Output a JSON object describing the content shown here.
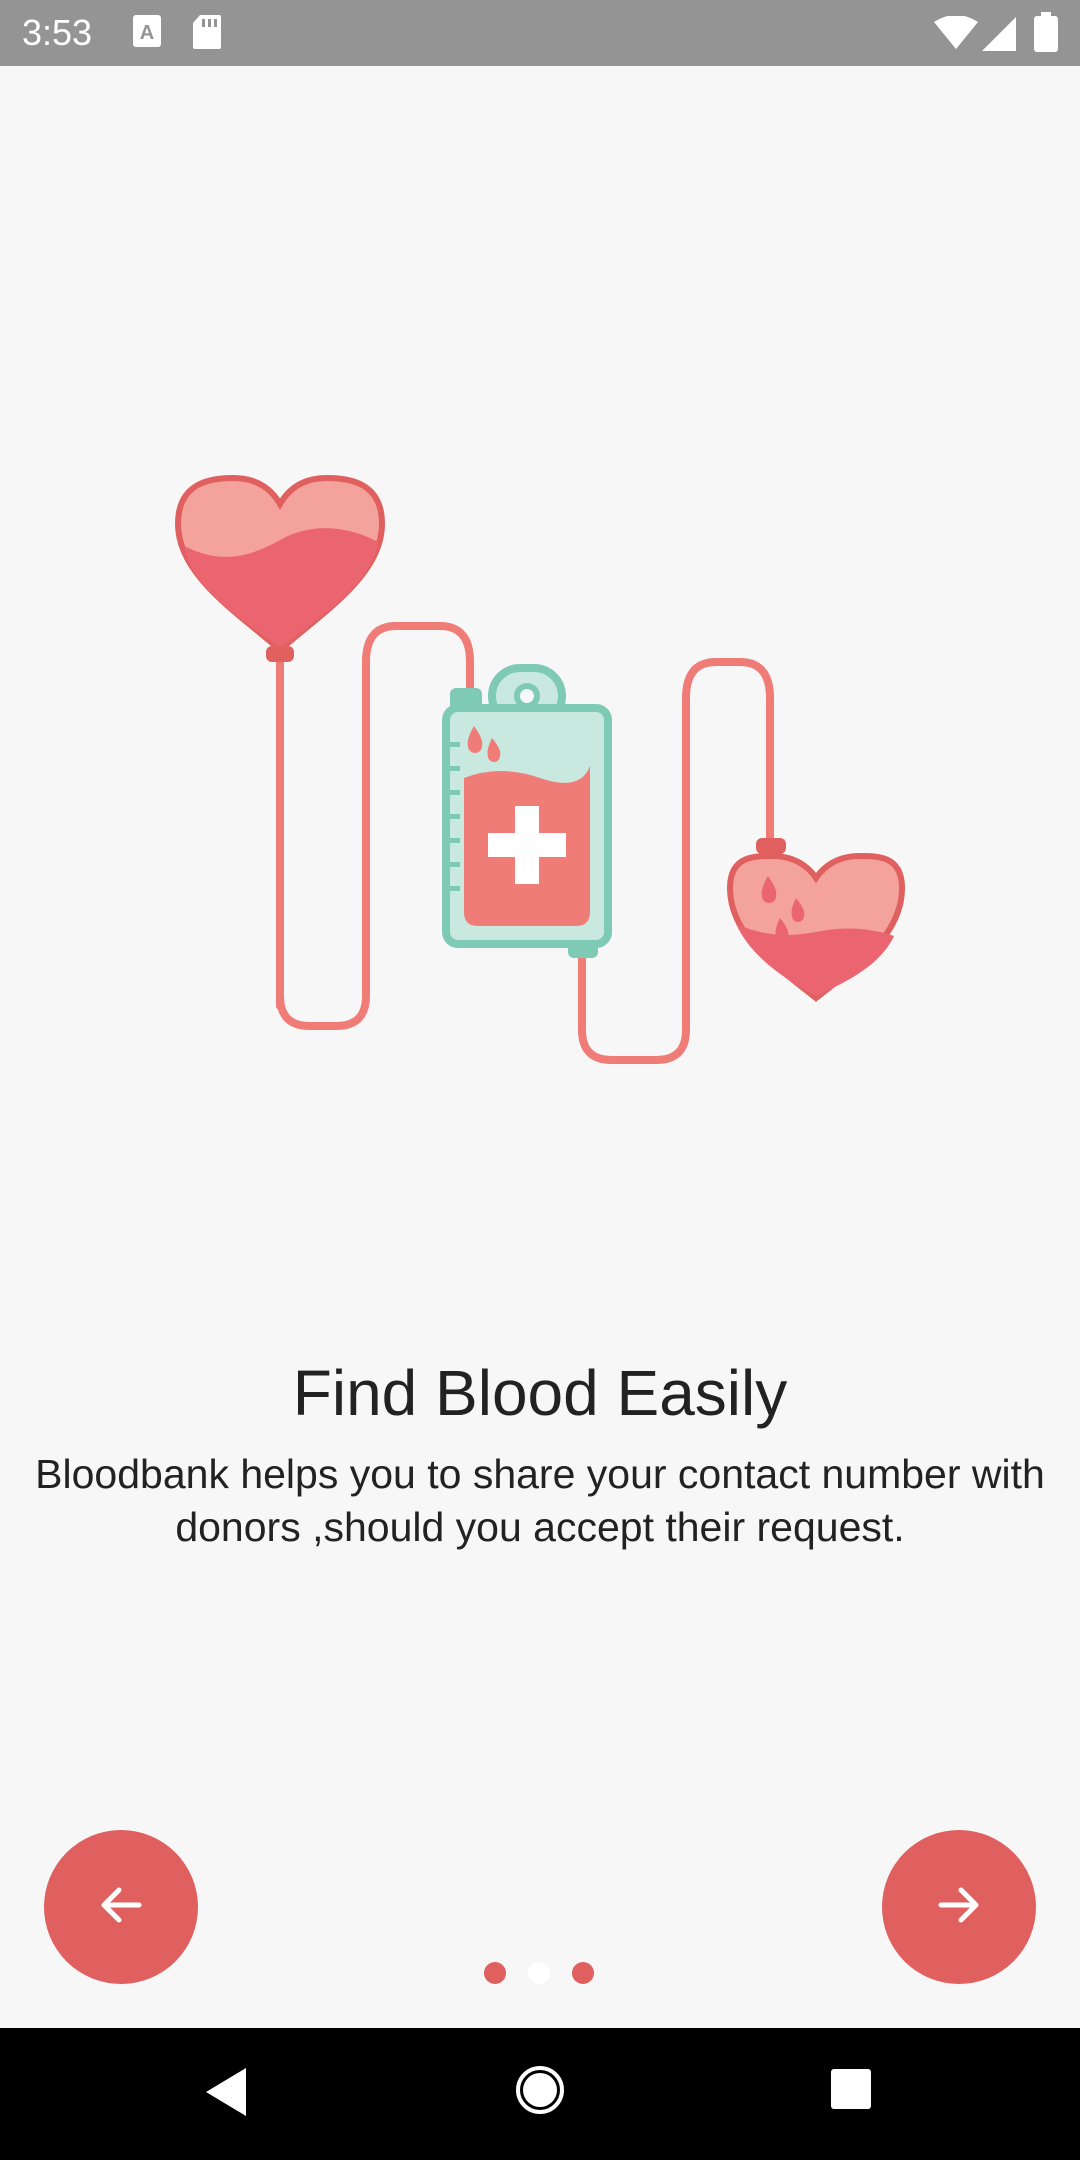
{
  "status_bar": {
    "time": "3:53",
    "icons_left": [
      "a-badge-icon",
      "sd-card-icon"
    ],
    "icons_right": [
      "wifi-icon",
      "signal-icon",
      "battery-icon"
    ]
  },
  "onboarding": {
    "title": "Find Blood Easily",
    "description": "Bloodbank helps you to share your contact number with donors ,should you accept their request.",
    "illustration": "blood-transfusion-illustration",
    "page_indicator": {
      "total": 3,
      "current": 2
    }
  },
  "buttons": {
    "prev_icon": "arrow-left-icon",
    "next_icon": "arrow-right-icon"
  },
  "colors": {
    "accent": "#e06060",
    "background": "#f7f7f7",
    "heart_light": "#f4a29c",
    "heart_dark": "#eb6570",
    "bag_green": "#7ecab5",
    "bag_fill": "#c9e8df",
    "blood": "#f07c78",
    "dot_active": "#ffffff",
    "dot_inactive": "#e06060"
  },
  "system_nav": {
    "keys": [
      "back-icon",
      "home-icon",
      "recents-icon"
    ]
  }
}
